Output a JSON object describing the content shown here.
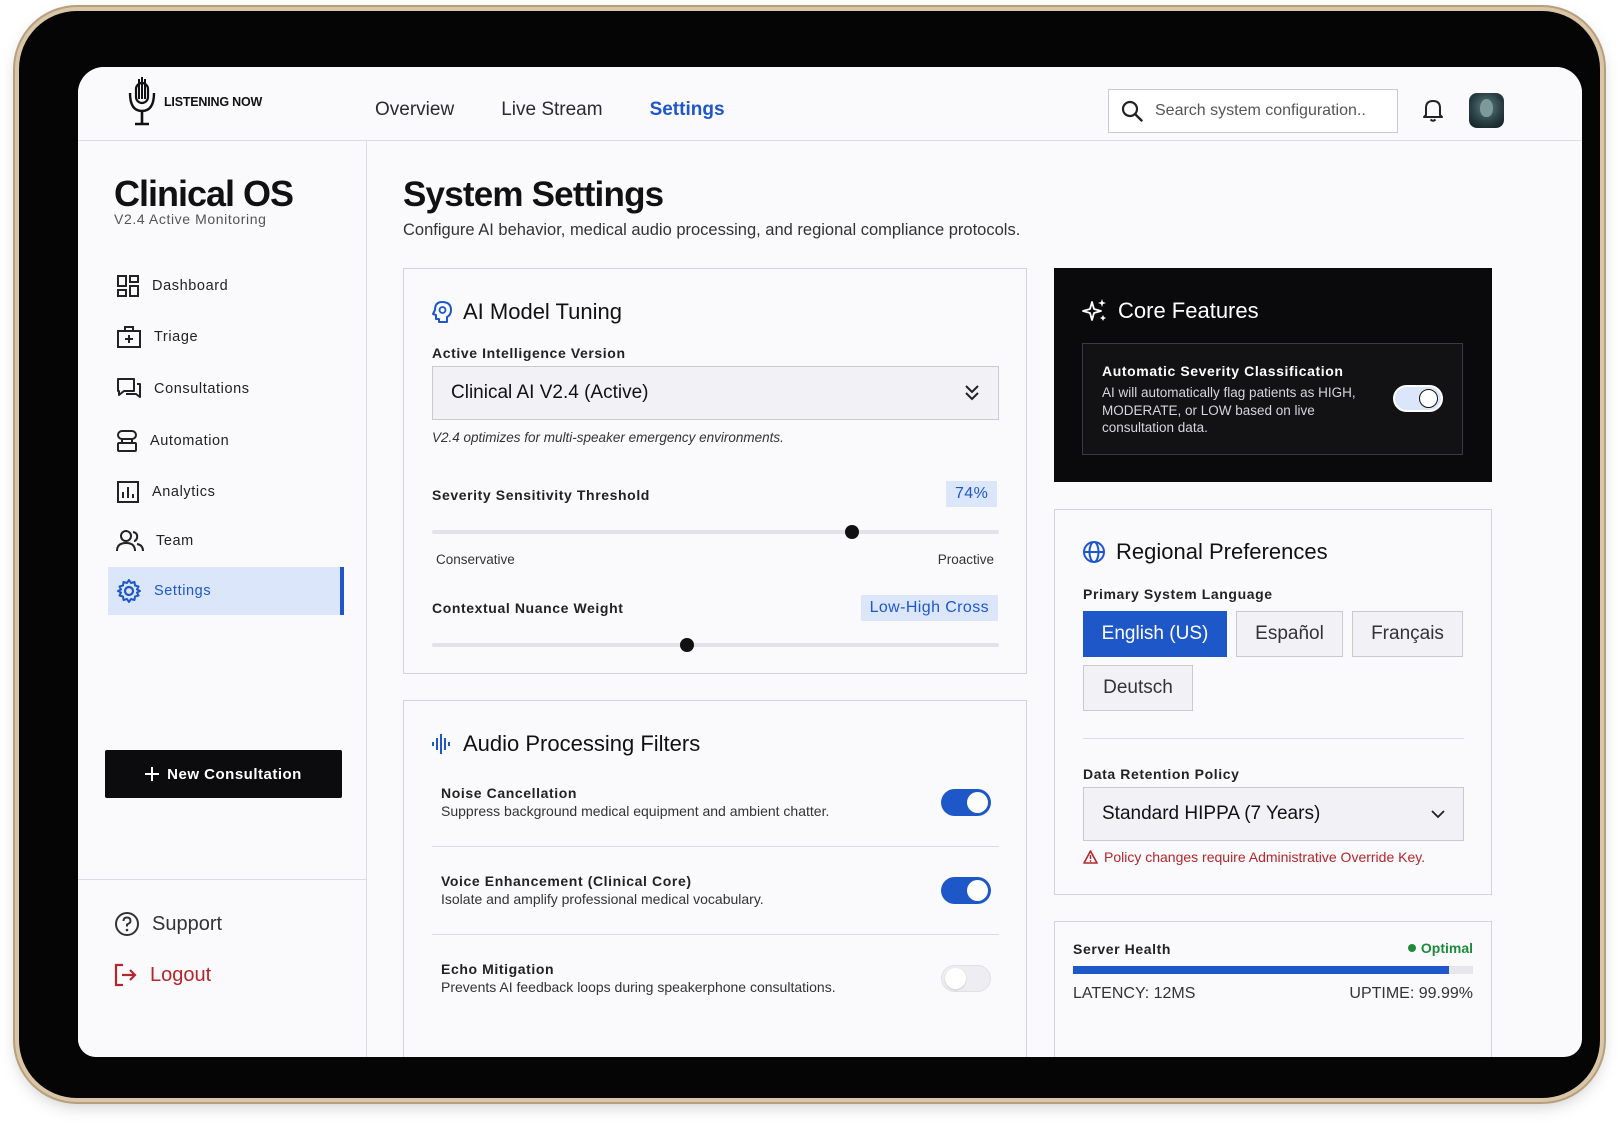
{
  "topbar": {
    "logo_text": "LISTENING NOW",
    "nav": [
      {
        "label": "Overview",
        "active": false
      },
      {
        "label": "Live Stream",
        "active": false
      },
      {
        "label": "Settings",
        "active": true
      }
    ],
    "search_placeholder": "Search system configuration.."
  },
  "sidebar": {
    "brand": "Clinical OS",
    "version": "V2.4 Active Monitoring",
    "items": [
      {
        "label": "Dashboard",
        "icon": "dashboard-icon"
      },
      {
        "label": "Triage",
        "icon": "medical-kit-icon"
      },
      {
        "label": "Consultations",
        "icon": "chat-icon"
      },
      {
        "label": "Automation",
        "icon": "automation-icon"
      },
      {
        "label": "Analytics",
        "icon": "analytics-icon"
      },
      {
        "label": "Team",
        "icon": "team-icon"
      },
      {
        "label": "Settings",
        "icon": "gear-icon",
        "active": true
      }
    ],
    "new_button": "New Consultation",
    "support": "Support",
    "logout": "Logout"
  },
  "main": {
    "title": "System Settings",
    "subtitle": "Configure AI behavior, medical audio processing, and regional compliance protocols."
  },
  "ai_tuning": {
    "title": "AI Model Tuning",
    "version_label": "Active Intelligence Version",
    "version_value": "Clinical AI V2.4 (Active)",
    "version_note": "V2.4 optimizes for multi-speaker emergency environments.",
    "sensitivity_label": "Severity Sensitivity Threshold",
    "sensitivity_value": "74%",
    "sensitivity_level": 0.74,
    "sensitivity_min": "Conservative",
    "sensitivity_max": "Proactive",
    "nuance_label": "Contextual Nuance Weight",
    "nuance_value": "Low-High Cross",
    "nuance_level": 0.45
  },
  "audio": {
    "title": "Audio Processing Filters",
    "filters": [
      {
        "name": "Noise Cancellation",
        "desc": "Suppress background medical equipment and ambient chatter.",
        "on": true
      },
      {
        "name": "Voice Enhancement (Clinical Core)",
        "desc": "Isolate and amplify professional medical vocabulary.",
        "on": true
      },
      {
        "name": "Echo Mitigation",
        "desc": "Prevents AI feedback loops during speakerphone consultations.",
        "on": false
      }
    ]
  },
  "core": {
    "title": "Core Features",
    "feature_title": "Automatic Severity Classification",
    "feature_desc": "AI will automatically flag patients as HIGH, MODERATE, or LOW based on live consultation data.",
    "feature_on": true
  },
  "regional": {
    "title": "Regional Preferences",
    "language_label": "Primary System Language",
    "languages": [
      {
        "label": "English (US)",
        "active": true
      },
      {
        "label": "Español",
        "active": false
      },
      {
        "label": "Français",
        "active": false
      },
      {
        "label": "Deutsch",
        "active": false
      }
    ],
    "retention_label": "Data Retention Policy",
    "retention_value": "Standard HIPPA (7 Years)",
    "warning": "Policy changes require Administrative Override Key."
  },
  "server": {
    "title": "Server Health",
    "status": "Optimal",
    "status_color": "#1f8a3a",
    "health_level": 0.94,
    "latency": "LATENCY: 12MS",
    "uptime": "UPTIME: 99.99%"
  },
  "colors": {
    "accent": "#1e57c8",
    "danger": "#b3262a",
    "dark": "#0a0a0c"
  }
}
